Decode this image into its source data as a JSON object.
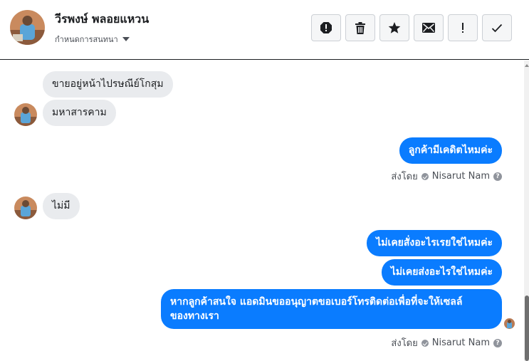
{
  "contact": {
    "name": "วีรพงษ์ พลอยแหวน",
    "conversation_menu": "กำหนดการสนทนา"
  },
  "toolbar": {
    "buttons": [
      {
        "icon": "alert-circle-icon"
      },
      {
        "icon": "trash-icon"
      },
      {
        "icon": "star-icon"
      },
      {
        "icon": "envelope-icon"
      },
      {
        "icon": "exclamation-icon"
      },
      {
        "icon": "checkmark-icon"
      }
    ]
  },
  "messages": {
    "m1": "ขายอยู่หน้าไปรษณีย์โกสุม",
    "m2": "มหาสารคาม",
    "m3": "ลูกค้ามีเคดิตไหมค่ะ",
    "m4": "ไม่มี",
    "m5": "ไม่เคยสั่งอะไรเรยใช่ไหมค่ะ",
    "m6": "ไม่เคยส่งอะไรใช่ไหมค่ะ",
    "m7_line1": "หากลูกค้าสนใจ แอดมินขออนุญาตขอเบอร์โทรติดต่อเพื่อที่จะให้เซลล์",
    "m7_line2": "ของทางเรา"
  },
  "sent_by": {
    "label": "ส่งโดย",
    "agent": "Nisarut Nam"
  },
  "colors": {
    "outgoing_bubble": "#0a7cff",
    "incoming_bubble": "#e9ebee"
  }
}
